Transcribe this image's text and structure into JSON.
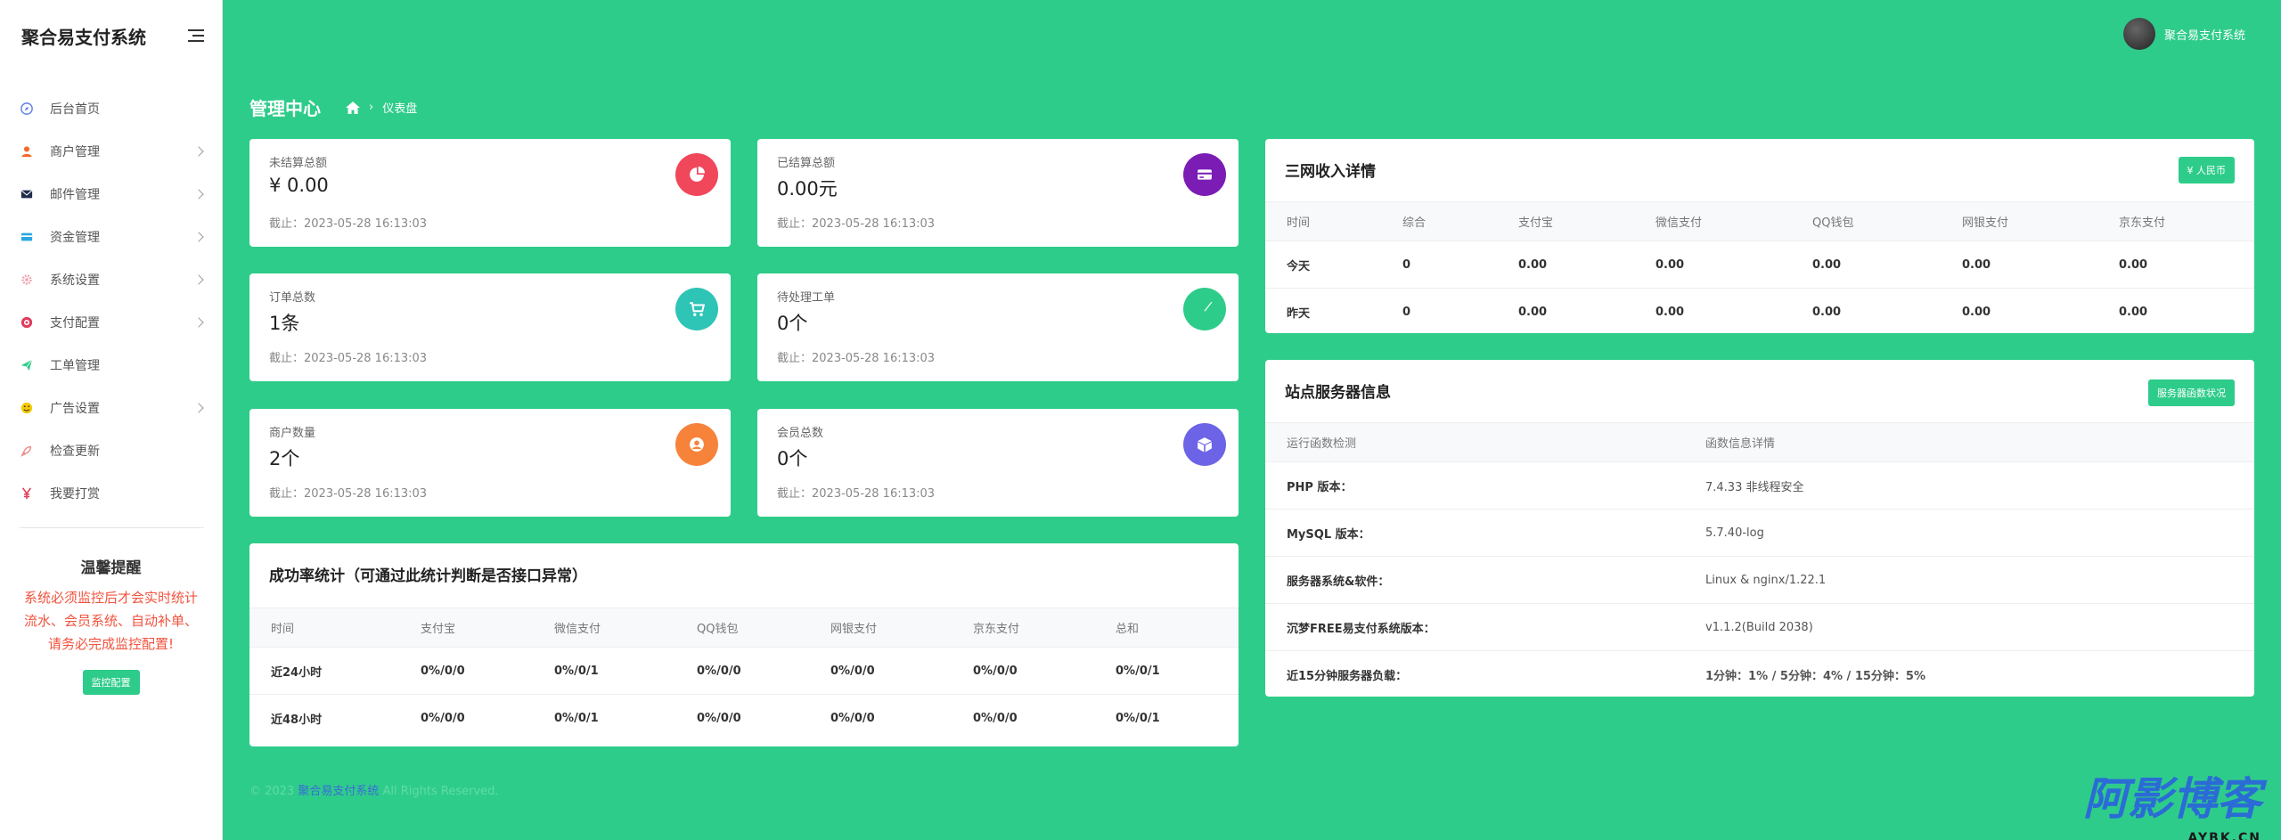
{
  "brand": {
    "title": "聚合易支付系统"
  },
  "sidebar": {
    "items": [
      {
        "label": "后台首页",
        "icon": "compass-icon",
        "color": "#5b7be8",
        "chevron": false
      },
      {
        "label": "商户管理",
        "icon": "user-icon",
        "color": "#f2692b",
        "chevron": true
      },
      {
        "label": "邮件管理",
        "icon": "mail-icon",
        "color": "#1f2d4d",
        "chevron": true
      },
      {
        "label": "资金管理",
        "icon": "card-icon",
        "color": "#2aa7e0",
        "chevron": true
      },
      {
        "label": "系统设置",
        "icon": "gear-icon",
        "color": "#f0a0b0",
        "chevron": true
      },
      {
        "label": "支付配置",
        "icon": "target-icon",
        "color": "#e03c5c",
        "chevron": true
      },
      {
        "label": "工单管理",
        "icon": "paper-plane-icon",
        "color": "#2ecc8a",
        "chevron": false
      },
      {
        "label": "广告设置",
        "icon": "smile-icon",
        "color": "#f5c800",
        "chevron": true
      },
      {
        "label": "检查更新",
        "icon": "rocket-icon",
        "color": "#f08080",
        "chevron": false
      },
      {
        "label": "我要打赏",
        "icon": "yen-icon",
        "color": "#e03c5c",
        "chevron": false
      }
    ]
  },
  "notice": {
    "title": "温馨提醒",
    "text": "系统必须监控后才会实时统计流水、会员系统、自动补单、请务必完成监控配置!",
    "button": "监控配置"
  },
  "topbar": {
    "user": "聚合易支付系统"
  },
  "page": {
    "title": "管理中心",
    "crumb": "仪表盘"
  },
  "stats": [
    {
      "label": "未结算总额",
      "value": "¥ 0.00",
      "time": "截止：2023-05-28 16:13:03",
      "color": "#f1475b",
      "icon": "pie-chart-icon"
    },
    {
      "label": "已结算总额",
      "value": "0.00元",
      "time": "截止：2023-05-28 16:13:03",
      "color": "#7b1cb5",
      "icon": "wallet-icon"
    },
    {
      "label": "订单总数",
      "value": "1条",
      "time": "截止：2023-05-28 16:13:03",
      "color": "#2ec4b6",
      "icon": "cart-icon"
    },
    {
      "label": "待处理工单",
      "value": "0个",
      "time": "截止：2023-05-28 16:13:03",
      "color": "#2ecc8a",
      "icon": "paper-plane-icon"
    },
    {
      "label": "商户数量",
      "value": "2个",
      "time": "截止：2023-05-28 16:13:03",
      "color": "#f7833a",
      "icon": "user-circle-icon"
    },
    {
      "label": "会员总数",
      "value": "0个",
      "time": "截止：2023-05-28 16:13:03",
      "color": "#6c63e6",
      "icon": "box-icon"
    }
  ],
  "success": {
    "title": "成功率统计（可通过此统计判断是否接口异常）",
    "headers": [
      "时间",
      "支付宝",
      "微信支付",
      "QQ钱包",
      "网银支付",
      "京东支付",
      "总和"
    ],
    "rows": [
      [
        "近24小时",
        "0%/0/0",
        "0%/0/1",
        "0%/0/0",
        "0%/0/0",
        "0%/0/0",
        "0%/0/1"
      ],
      [
        "近48小时",
        "0%/0/0",
        "0%/0/1",
        "0%/0/0",
        "0%/0/0",
        "0%/0/0",
        "0%/0/1"
      ]
    ]
  },
  "income": {
    "title": "三网收入详情",
    "button": "¥ 人民币",
    "headers": [
      "时间",
      "综合",
      "支付宝",
      "微信支付",
      "QQ钱包",
      "网银支付",
      "京东支付"
    ],
    "rows": [
      [
        "今天",
        "0",
        "0.00",
        "0.00",
        "0.00",
        "0.00",
        "0.00"
      ],
      [
        "昨天",
        "0",
        "0.00",
        "0.00",
        "0.00",
        "0.00",
        "0.00"
      ]
    ]
  },
  "server": {
    "title": "站点服务器信息",
    "button": "服务器函数状况",
    "headers": [
      "运行函数检测",
      "函数信息详情"
    ],
    "rows": [
      [
        "PHP 版本：",
        "7.4.33 非线程安全"
      ],
      [
        "MySQL 版本：",
        "5.7.40-log"
      ],
      [
        "服务器系统&软件：",
        "Linux & nginx/1.22.1"
      ],
      [
        "沉梦FREE易支付系统版本：",
        "v1.1.2(Build 2038)"
      ],
      [
        "近15分钟服务器负载：",
        "1分钟：1% / 5分钟：4% / 15分钟：5%"
      ]
    ]
  },
  "footer": {
    "prefix": "© 2023",
    "link": "聚合易支付系统",
    "suffix": " All Rights Reserved."
  },
  "watermark": {
    "main": "阿影博客",
    "sub": "AYBK.CN"
  }
}
